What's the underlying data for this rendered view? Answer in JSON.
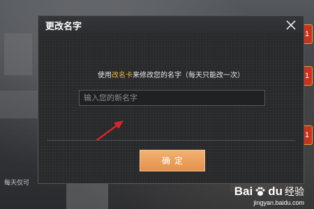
{
  "dialog": {
    "title": "更改名字",
    "instruction_prefix": "使用",
    "instruction_highlight": "改名卡",
    "instruction_suffix": "来修改您的名字（每天只能改一次）",
    "input_placeholder": "输入您的新名字",
    "input_value": "",
    "confirm_label": "确定"
  },
  "background": {
    "badges": [
      "1",
      "1",
      "1"
    ],
    "side_label": "每天仅可"
  },
  "watermark": {
    "brand_latin": "Bai",
    "brand_latin2": "du",
    "brand_cn": "经验",
    "url": "jingyan.baidu.com"
  },
  "colors": {
    "accent_highlight": "#f2b33d",
    "confirm_button": "#e99a52",
    "arrow": "#d7262b"
  }
}
